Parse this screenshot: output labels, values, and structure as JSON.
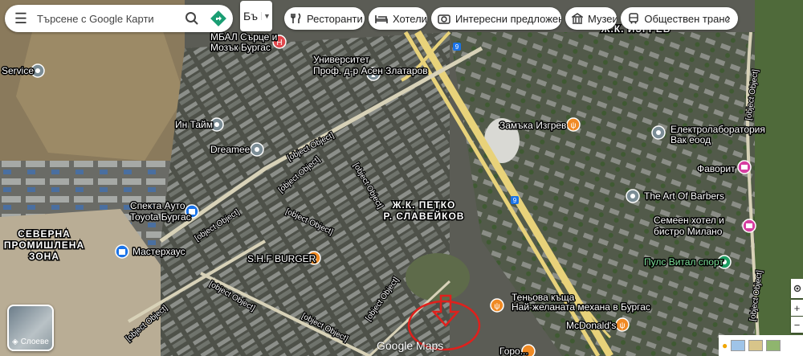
{
  "search": {
    "placeholder": "Търсене с Google Карти"
  },
  "language_button": {
    "label": "Бъ"
  },
  "chips": [
    {
      "label": "Ресторанти",
      "icon": "fork-knife-icon"
    },
    {
      "label": "Хотели",
      "icon": "bed-icon"
    },
    {
      "label": "Интересни предложени...",
      "icon": "camera-icon"
    },
    {
      "label": "Музеи",
      "icon": "museum-icon"
    },
    {
      "label": "Обществен транс",
      "icon": "bus-icon"
    }
  ],
  "layers_button": {
    "label": "Слоеве"
  },
  "logo": {
    "text": "Google Maps"
  },
  "places": [
    {
      "name": "МБАЛ Сърце и",
      "line2": "Мозък Бургас",
      "kind": "hospital",
      "color": "#e0474c"
    },
    {
      "name": "Service",
      "kind": "generic",
      "color": "#7b8d96"
    },
    {
      "name": "Университет",
      "line2": "Проф. д-р Асен Златаров",
      "kind": "school",
      "color": "#7b8d96"
    },
    {
      "name": "Ин Тайм",
      "kind": "generic",
      "color": "#7b8d96"
    },
    {
      "name": "Dreamee",
      "kind": "generic",
      "color": "#7b8d96"
    },
    {
      "name": "Спекта Ауто",
      "line2": "Toyota Бургас",
      "kind": "shopping",
      "color": "#1a73e8"
    },
    {
      "name": "Мастерхаус",
      "kind": "shopping",
      "color": "#1a73e8"
    },
    {
      "name": "Замъка Изгрев",
      "kind": "restaurant",
      "color": "#f08a24"
    },
    {
      "name": "Електролаборатория",
      "line2": "Вак еоод",
      "kind": "generic",
      "color": "#7b8d96"
    },
    {
      "name": "Фаворит",
      "kind": "hotel",
      "color": "#d63ea0"
    },
    {
      "name": "The Art Of Barbers",
      "kind": "generic",
      "color": "#7b8d96"
    },
    {
      "name": "Семеен хотел и",
      "line2": "бистро Милано",
      "kind": "hotel",
      "color": "#d63ea0"
    },
    {
      "name": "Пулс Витал спорт",
      "kind": "park",
      "color": "#1e9e63"
    },
    {
      "name": "S.H.F BURGER",
      "kind": "restaurant",
      "color": "#f08a24"
    },
    {
      "name": "Теньова къща",
      "line2": "Най-желаната механа в Бургас",
      "kind": "restaurant",
      "color": "#f08a24"
    },
    {
      "name": "McDonald's",
      "kind": "restaurant",
      "color": "#f08a24"
    },
    {
      "name": "Горо...",
      "kind": "restaurant",
      "color": "#f08a24"
    }
  ],
  "districts": [
    {
      "name": "Ж.К. ИЗГРЕВ"
    },
    {
      "name": "Ж.К. ПЕТКО",
      "line2": "Р. СЛАВЕЙКОВ"
    },
    {
      "name": "СЕВЕРНА",
      "line2": "ПРОМИШЛЕНА",
      "line3": "ЗОНА"
    }
  ],
  "roads": [
    {
      "name": "ул. „Професор Яким Якимов“"
    },
    {
      "name": "ул. „Професор Яким Якимов“"
    },
    {
      "name": "ул. „Професор Яким Якимов“"
    },
    {
      "name": "ж.к. Петко Р. Славейков"
    },
    {
      "name": "ж.к. Петко Р. Славейков"
    },
    {
      "name": "ж.к. Славейков"
    },
    {
      "name": "бул. „Янко Комитов“"
    },
    {
      "name": "бул. „Янко Комитов“"
    },
    {
      "name": "ул. „Тракия“"
    },
    {
      "name": "ул. „Димитър Димов“"
    },
    {
      "name": "ул. „Димитър Димов“"
    },
    {
      "name": "ж.к. Изгрев"
    }
  ],
  "route_shields": [
    "9",
    "9"
  ],
  "colors": {
    "imagery_base": "#5b5c55",
    "road_yellow": "#e8d27a",
    "annotation_red": "#e0201c"
  }
}
